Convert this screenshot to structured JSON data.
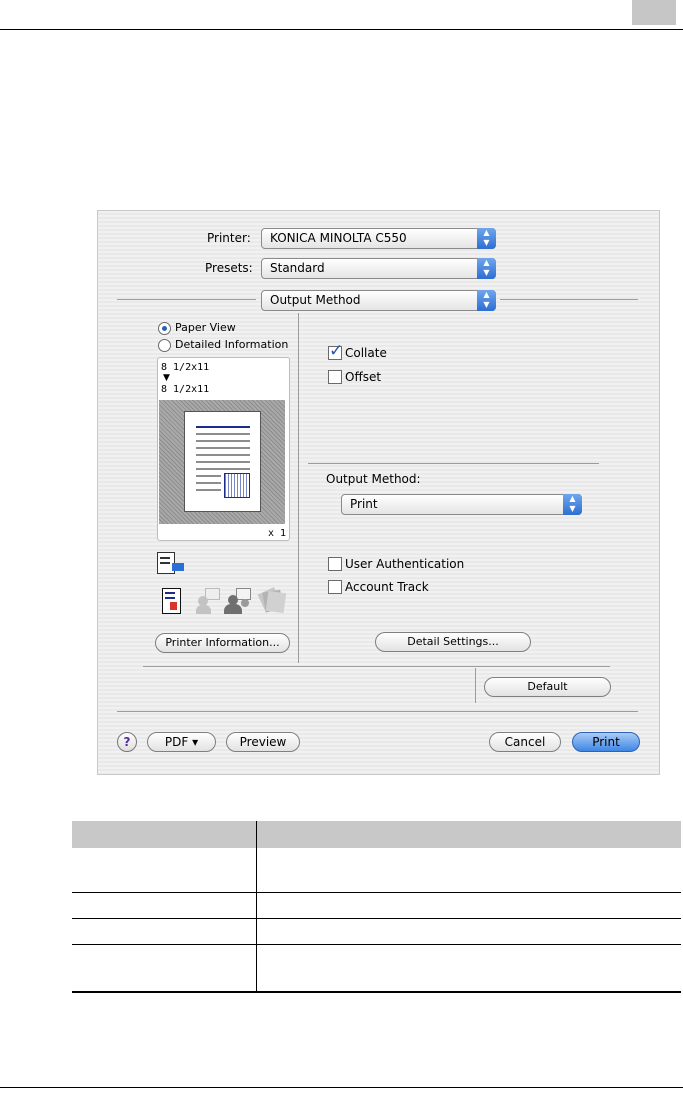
{
  "dialog": {
    "printer_label": "Printer:",
    "printer_value": "KONICA MINOLTA C550",
    "presets_label": "Presets:",
    "presets_value": "Standard",
    "panel_value": "Output Method",
    "view_options": [
      "Paper View",
      "Detailed Information"
    ],
    "paper_source": "8 1/2x11",
    "paper_output": "8 1/2x11",
    "copies": "x 1",
    "collate_label": "Collate",
    "collate_checked": true,
    "offset_label": "Offset",
    "offset_checked": false,
    "output_method_label": "Output Method:",
    "output_method_value": "Print",
    "user_auth_label": "User Authentication",
    "account_track_label": "Account Track",
    "printer_info_button": "Printer Information...",
    "detail_settings_button": "Detail Settings...",
    "default_button": "Default",
    "help_button": "?",
    "pdf_button": "PDF ▾",
    "preview_button": "Preview",
    "cancel_button": "Cancel",
    "print_button": "Print"
  },
  "colors": {
    "accent_blue": "#3f86e4",
    "table_header": "#c8c8c8"
  },
  "table": {
    "rows": 4
  }
}
